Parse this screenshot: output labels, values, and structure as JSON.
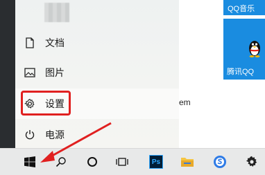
{
  "start_menu": {
    "items": [
      {
        "label": "文档",
        "icon": "document-icon"
      },
      {
        "label": "图片",
        "icon": "picture-icon"
      },
      {
        "label": "设置",
        "icon": "gear-icon"
      },
      {
        "label": "电源",
        "icon": "power-icon"
      }
    ]
  },
  "partial_text": "em",
  "tiles": {
    "music_label": "QQ音乐",
    "qq_label": "腾讯QQ"
  },
  "taskbar": {
    "ps_label": "Ps"
  },
  "colors": {
    "accent": "#1a8ce0",
    "highlight": "#e02020"
  }
}
